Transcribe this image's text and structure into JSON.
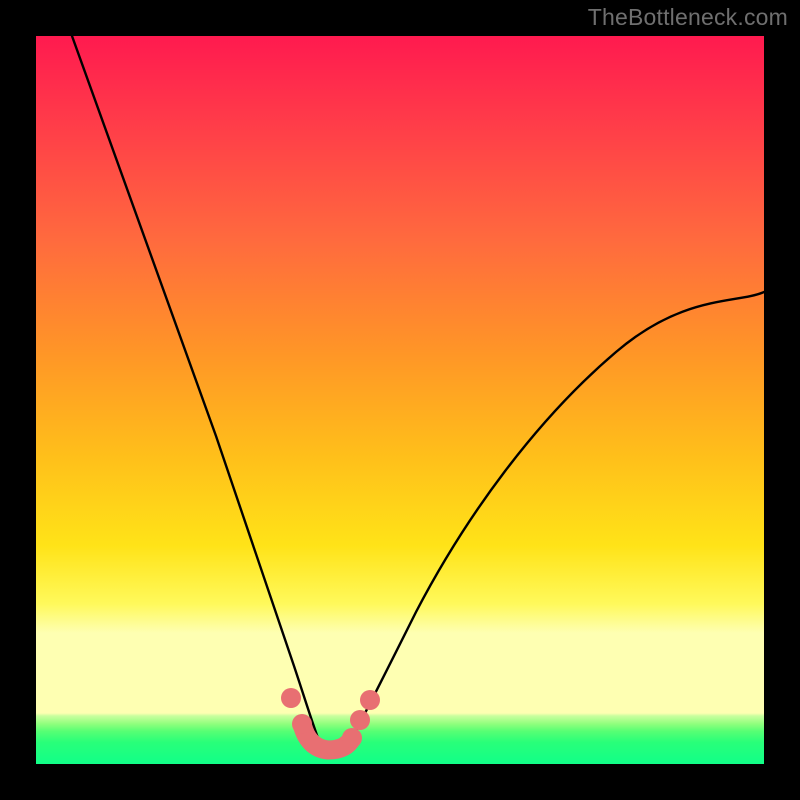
{
  "watermark": "TheBottleneck.com",
  "colors": {
    "frame_bg": "#000000",
    "watermark_text": "#6f6f6f",
    "curve_stroke": "#000000",
    "marker_fill": "#e86f72",
    "gradient_top": "#ff1a4f",
    "gradient_upper_mid": "#ff9726",
    "gradient_yellow": "#ffe318",
    "gradient_pale_band": "#feffb2",
    "gradient_green": "#11ff88"
  },
  "chart_data": {
    "type": "line",
    "title": "",
    "xlabel": "",
    "ylabel": "",
    "xlim": [
      0,
      100
    ],
    "ylim": [
      0,
      100
    ],
    "series": [
      {
        "name": "left-curve",
        "x": [
          5,
          10,
          15,
          20,
          25,
          30,
          32,
          34,
          36,
          38
        ],
        "values": [
          100,
          82,
          64,
          48,
          33,
          20,
          15,
          10,
          6,
          3
        ]
      },
      {
        "name": "right-curve",
        "x": [
          43,
          45,
          47,
          50,
          55,
          60,
          65,
          75,
          85,
          95,
          100
        ],
        "values": [
          3,
          6,
          9,
          14,
          23,
          31,
          38,
          48,
          56,
          62,
          65
        ]
      }
    ],
    "markers": [
      {
        "name": "left-high-dot",
        "x": 35.0,
        "y": 9.0
      },
      {
        "name": "left-low-dot",
        "x": 36.5,
        "y": 5.5
      },
      {
        "name": "right-top-dot",
        "x": 46.0,
        "y": 8.5
      },
      {
        "name": "right-mid-dot",
        "x": 44.5,
        "y": 6.0
      },
      {
        "name": "right-low-dot",
        "x": 43.0,
        "y": 3.5
      }
    ],
    "u_marker_path": [
      {
        "x": 36.5,
        "y": 5.5
      },
      {
        "x": 37.5,
        "y": 2.5
      },
      {
        "x": 40.0,
        "y": 2.0
      },
      {
        "x": 42.5,
        "y": 2.5
      },
      {
        "x": 43.0,
        "y": 3.5
      }
    ],
    "legend": null,
    "grid": false
  }
}
